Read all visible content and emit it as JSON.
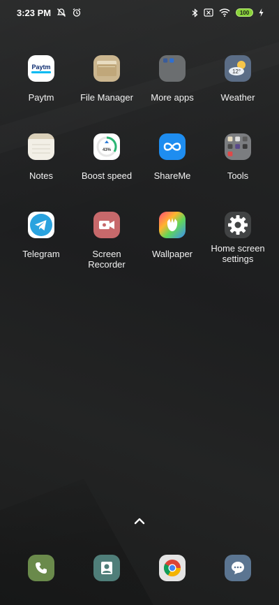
{
  "status_bar": {
    "time": "3:23 PM",
    "battery": "100",
    "icons": [
      "notifications-off-icon",
      "alarm-icon",
      "bluetooth-icon",
      "sim-missing-icon",
      "wifi-icon",
      "battery-icon",
      "charging-icon"
    ]
  },
  "apps": [
    {
      "label": "Paytm",
      "icon": "paytm-icon"
    },
    {
      "label": "File Manager",
      "icon": "folder-icon"
    },
    {
      "label": "More apps",
      "icon": "folder-more-apps-icon"
    },
    {
      "label": "Weather",
      "icon": "weather-icon",
      "temp": "12°"
    },
    {
      "label": "Notes",
      "icon": "notes-icon"
    },
    {
      "label": "Boost speed",
      "icon": "boost-icon",
      "percent": "43%"
    },
    {
      "label": "ShareMe",
      "icon": "shareme-icon"
    },
    {
      "label": "Tools",
      "icon": "tools-folder-icon"
    },
    {
      "label": "Telegram",
      "icon": "telegram-icon"
    },
    {
      "label": "Screen\nRecorder",
      "icon": "screen-recorder-icon"
    },
    {
      "label": "Wallpaper",
      "icon": "wallpaper-icon"
    },
    {
      "label": "Home screen\nsettings",
      "icon": "gear-icon"
    }
  ],
  "paytm_wordmark": "Paytm",
  "dock": [
    {
      "icon": "phone-icon"
    },
    {
      "icon": "contacts-icon"
    },
    {
      "icon": "chrome-icon"
    },
    {
      "icon": "messages-icon"
    }
  ],
  "colors": {
    "battery": "#8ad33a",
    "shareme": "#1e8df0",
    "telegram": "#2aa3df"
  }
}
